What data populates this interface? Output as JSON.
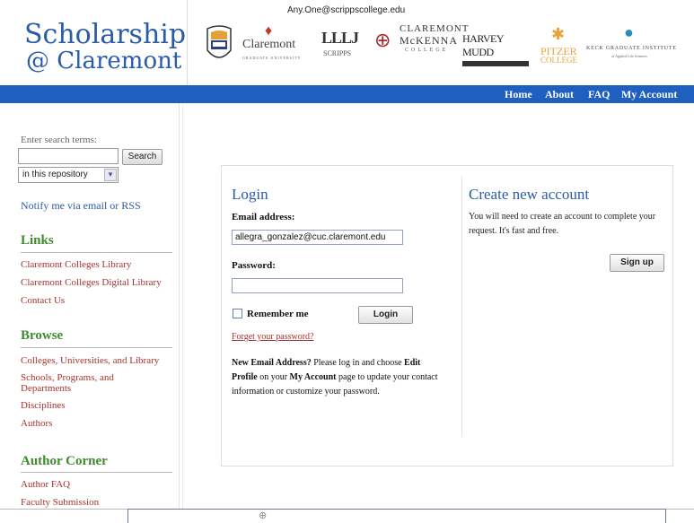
{
  "header": {
    "site_title_line1": "Scholarship",
    "site_title_line2": "@ Claremont",
    "account_email": "Any.One@scrippscollege.edu",
    "logos": {
      "claremont_name": "Claremont",
      "claremont_tag": "GRADUATE UNIVERSITY",
      "scripps_name": "SCRIPPS",
      "cmc_line1": "CLAREMONT",
      "cmc_line2": "McKENNA",
      "cmc_line3": "COLLEGE",
      "hmc_name": "HARVEY MUDD",
      "pitzer_line1": "PITZER",
      "pitzer_line2": "COLLEGE",
      "kgi_line1": "KECK GRADUATE INSTITUTE",
      "kgi_line2": "of Applied Life Sciences"
    }
  },
  "nav": {
    "home": "Home",
    "about": "About",
    "faq": "FAQ",
    "my_account": "My Account"
  },
  "sidebar": {
    "search_label": "Enter search terms:",
    "search_value": "",
    "search_button": "Search",
    "scope_selected": "in this repository",
    "notify_link": "Notify me via email or RSS",
    "links_heading": "Links",
    "links": [
      "Claremont Colleges Library",
      "Claremont Colleges Digital Library",
      "Contact Us"
    ],
    "browse_heading": "Browse",
    "browse": [
      "Colleges, Universities, and Library",
      "Schools, Programs, and Departments",
      "Disciplines",
      "Authors"
    ],
    "author_heading": "Author Corner",
    "author": [
      "Author FAQ",
      "Faculty Submission"
    ]
  },
  "login": {
    "title": "Login",
    "email_label": "Email address:",
    "email_value": "allegra_gonzalez@cuc.claremont.edu",
    "password_label": "Password:",
    "remember_label": "Remember me",
    "remember_checked": false,
    "login_button": "Login",
    "forgot_link": "Forget your password?",
    "note_part1": "New Email Address?",
    "note_part2": " Please log in and choose ",
    "note_part3": "Edit Profile",
    "note_part4": " on your ",
    "note_part5": "My Account",
    "note_part6": " page to update your contact information or customize your password."
  },
  "create_account": {
    "title": "Create new account",
    "text": "You will need to create an account to complete your request. It's fast and free.",
    "signup_button": "Sign up"
  },
  "colors": {
    "nav_bar": "#1f5fbf",
    "title_blue": "#2a5ca8",
    "heading_green": "#3f8a2f",
    "link_red": "#a8322d"
  }
}
